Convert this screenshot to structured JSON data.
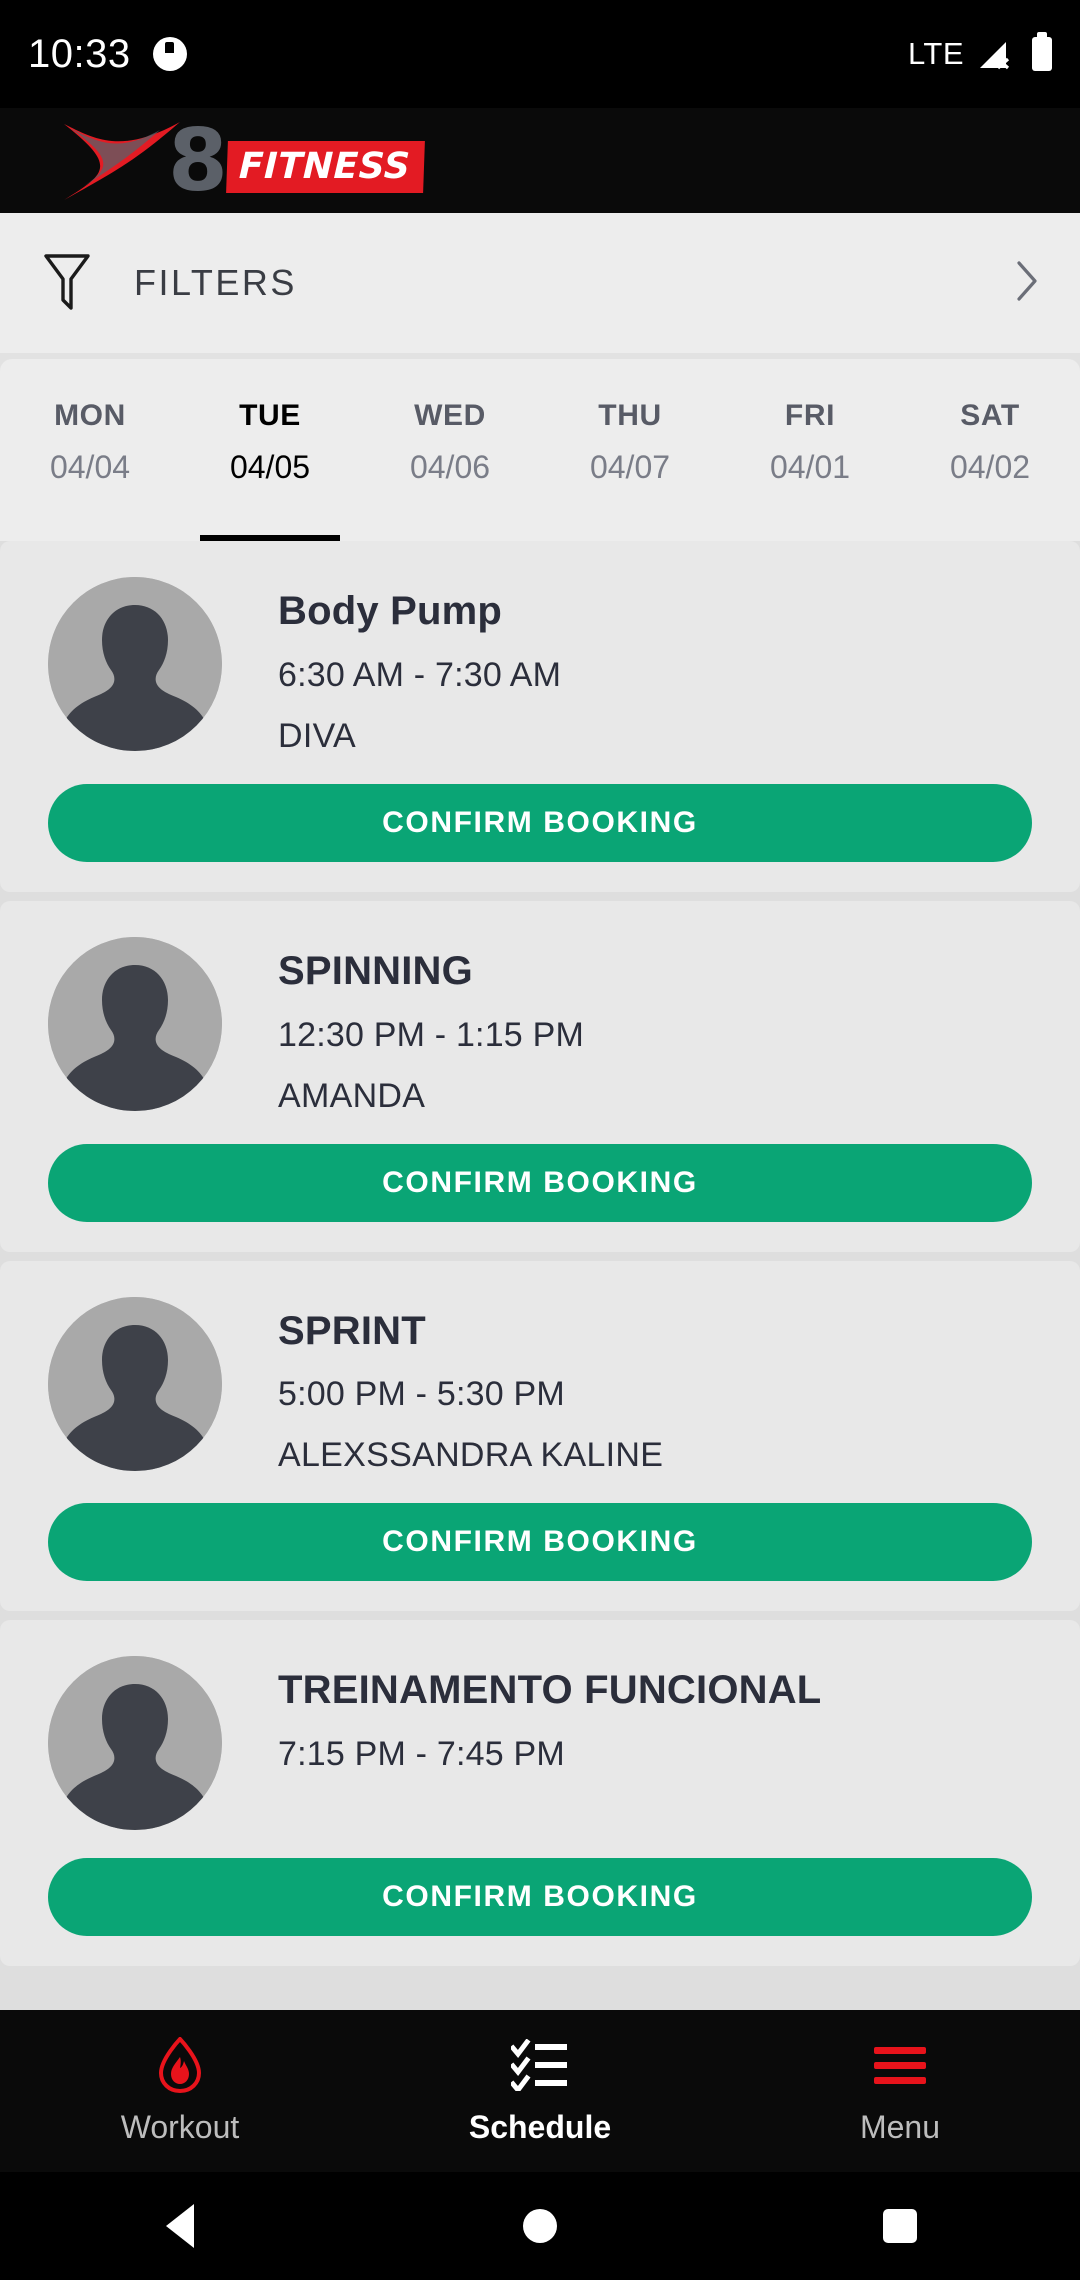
{
  "status_bar": {
    "time": "10:33",
    "app_icon": "app-notification-icon",
    "network": "LTE",
    "signal_icon": "signal-no-service-icon",
    "battery_icon": "battery-full-icon"
  },
  "header": {
    "logo_x": "X",
    "logo_eight": "8",
    "logo_fitness": "FITNESS",
    "brand_red": "#E31B23",
    "brand_gray": "#5B6068"
  },
  "filters": {
    "icon": "funnel-filter-icon",
    "label": "FILTERS",
    "chevron": "chevron-right-icon"
  },
  "day_tabs": [
    {
      "day": "MON",
      "date": "04/04",
      "active": false
    },
    {
      "day": "TUE",
      "date": "04/05",
      "active": true
    },
    {
      "day": "WED",
      "date": "04/06",
      "active": false
    },
    {
      "day": "THU",
      "date": "04/07",
      "active": false
    },
    {
      "day": "FRI",
      "date": "04/01",
      "active": false
    },
    {
      "day": "SAT",
      "date": "04/02",
      "active": false
    }
  ],
  "classes": [
    {
      "title": "Body Pump",
      "time": "6:30 AM - 7:30 AM",
      "instructor": "DIVA",
      "button_label": "CONFIRM BOOKING",
      "avatar": "person-placeholder-avatar"
    },
    {
      "title": "SPINNING",
      "time": "12:30 PM - 1:15 PM",
      "instructor": "AMANDA",
      "button_label": "CONFIRM BOOKING",
      "avatar": "person-placeholder-avatar"
    },
    {
      "title": "SPRINT",
      "time": "5:00 PM - 5:30 PM",
      "instructor": "ALEXSSANDRA KALINE",
      "button_label": "CONFIRM BOOKING",
      "avatar": "person-placeholder-avatar"
    },
    {
      "title": "TREINAMENTO FUNCIONAL",
      "time": "7:15 PM - 7:45 PM",
      "instructor": "",
      "button_label": "CONFIRM BOOKING",
      "avatar": "person-placeholder-avatar"
    }
  ],
  "bottom_nav": [
    {
      "label": "Workout",
      "icon": "flame-icon",
      "active": false
    },
    {
      "label": "Schedule",
      "icon": "checklist-icon",
      "active": true
    },
    {
      "label": "Menu",
      "icon": "hamburger-menu-icon",
      "active": false
    }
  ],
  "android_nav": {
    "back": "back-triangle-icon",
    "home": "home-circle-icon",
    "recents": "recents-square-icon"
  },
  "colors": {
    "accent_green": "#0AA575",
    "brand_red": "#E31B23",
    "page_background": "#EDEDED",
    "card_background": "#E8E8E8"
  }
}
